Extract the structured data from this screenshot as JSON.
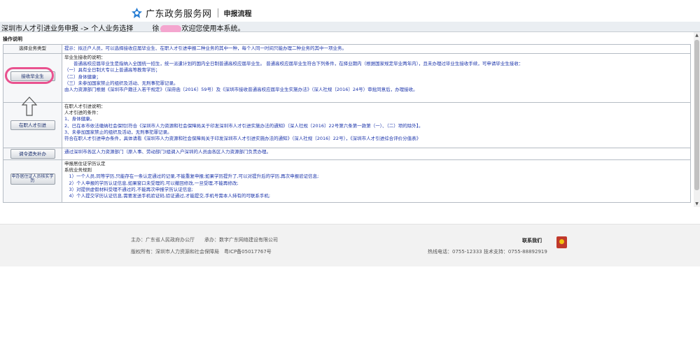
{
  "header": {
    "site_name": "广东政务服务网",
    "sub_title": "申报流程"
  },
  "breadcrumb": {
    "path": "深圳市人才引进业务申报 -> 个人业务选择",
    "user_prefix": "徐",
    "welcome": "欢迎您使用本系统。"
  },
  "main": {
    "section_title": "操作说明",
    "head": {
      "label": "选择业务类型",
      "hint": "提示：拟迁户人员，可以选择接收应届毕业生、在职人才引进申报二种业务的其中一种，每个人同一时间只能办理二种业务的其中一项业务。"
    },
    "rows": [
      {
        "button": "接收毕业生",
        "lines": [
          "毕业生接收的说明：",
          "　　普通高校应届毕业生是指纳入全国统一招生，统一派遣计划的国内全日制普通高校应届毕业生。 普通高校应届毕业生符合下列条件，在择业期内（根据国家规定毕业两年内），且未办理过毕业生接收手续，可申请毕业生接收：",
          "（一）具有全日制大专以上普通高等教育学历；",
          "（二）身体健康；",
          "（三）未参加国家禁止的组织及活动、无刑事犯罪记录。",
          "由人力资源部门根据《深圳市户籍迁入若干规定》（深府函〔2016〕59号）及《深圳市接收普通高校应届毕业生实施办法》（深人社规〔2016〕24号）审批同意后，办理接收。"
        ]
      },
      {
        "button": "在职人才引进",
        "lines": [
          "在职人才引进说明：",
          "人才引进的条件：",
          "1、身体健康。",
          "2、已在本市依法缴纳社会保险[符合《深圳市人力资源和社会保障局关于印发深圳市人才引进实施办法的通知》（深人社规〔2016〕22号第六条第一款第（一）、（二）项的除外】。",
          "3、未参加国家禁止的组织及活动，无刑事犯罪记录。",
          "符合在职人才引进申办条件，具体请看《深圳市人力资源和社会保障局关于印发深圳市人才引进实施办法的通知》（深人社规〔2016〕22号），《深圳市人才引进综合评价分值表》"
        ]
      },
      {
        "button": "调令遗失补办",
        "lines": [
          "通过深圳市各区人力资源部门（原人事、劳动部门)组调入户深圳的人员由各区人力资源部门负责办理。"
        ]
      },
      {
        "button": "申办居住证人员核实学历",
        "lines": [
          "申报居住证学历认定",
          "系统业务规则",
          "　1）一个人员,同等学历,只能存在一条认定通过的记录,不能重复申报;如果学历提升了,可以对提升后的学历,再次申报验证信息;",
          "　2）个人申报的学历认证信息,如果窗口未受理的,可以撤回修改,一旦受理,不能再修改;",
          "　3）对提供虚假材料受理不通过的,不能再次申报学历认证信息;",
          "　4）个人提交学历认证信息,需要发送手机验证码,验证通过,才能提交,手机号需本人持有的可联系手机;"
        ]
      }
    ]
  },
  "footer": {
    "sponsor": "主办：广东省人民政府办公厅　　承办：数字广东网络建设有限公司",
    "copyright": "版权所有：深圳市人力资源和社会保障局　粤ICP备05017767号",
    "contact_title": "联系我们",
    "hotline": "热线电话：0755-12333 技术支持：0755-88892919"
  }
}
